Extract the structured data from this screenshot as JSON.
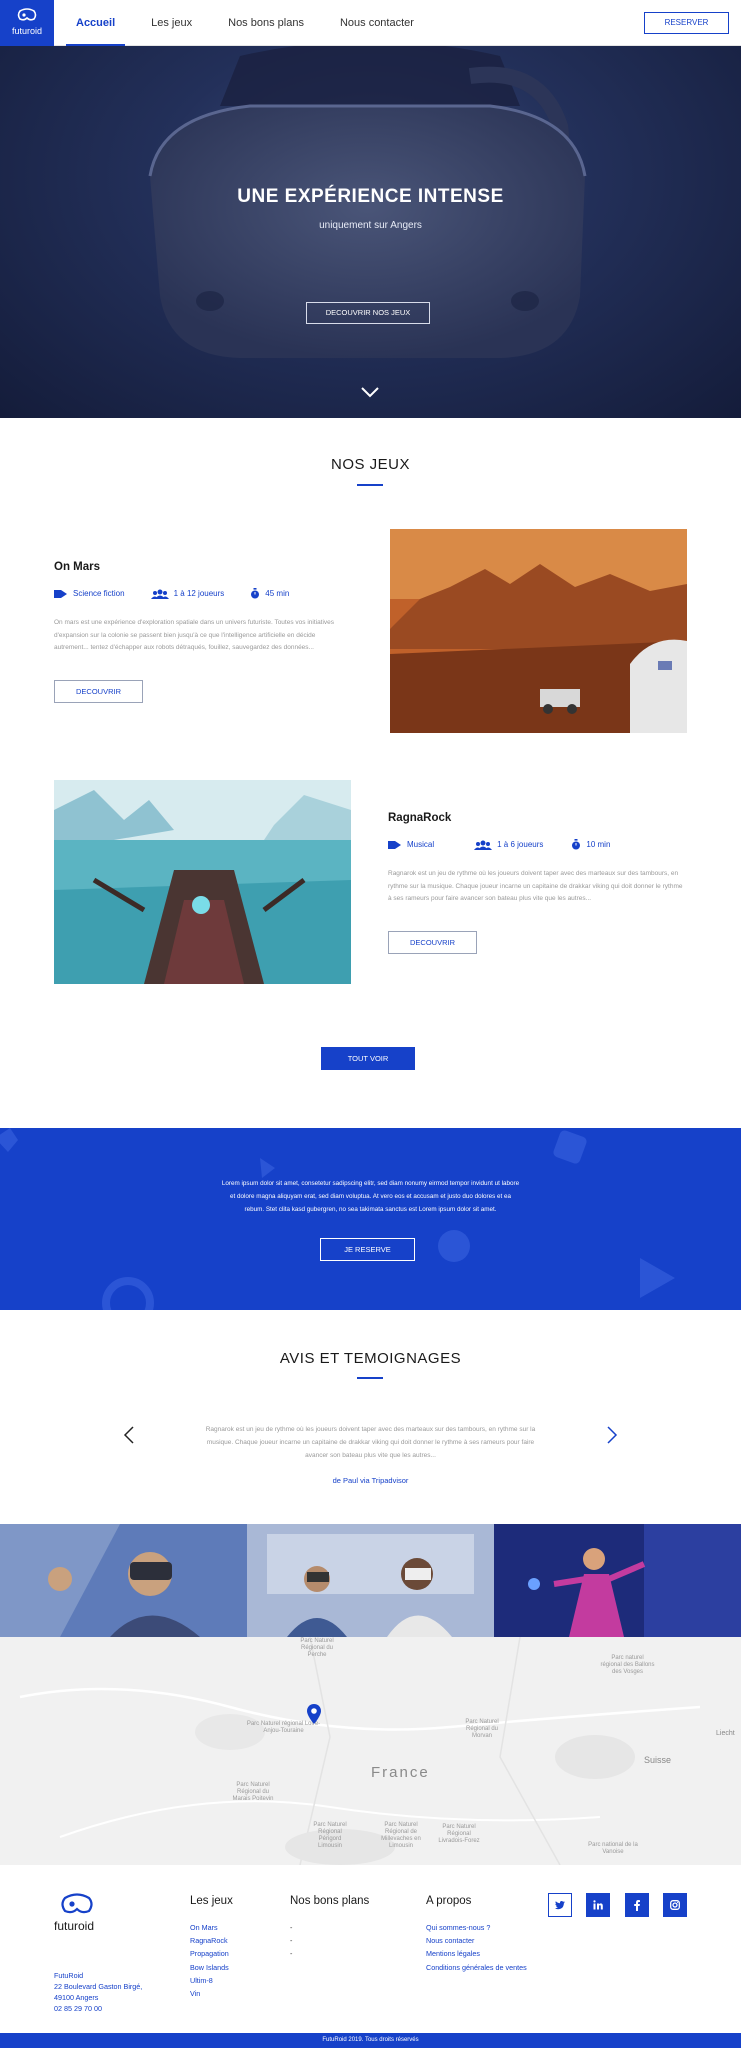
{
  "header": {
    "logo_text": "futuroid",
    "nav": [
      "Accueil",
      "Les jeux",
      "Nos bons plans",
      "Nous contacter"
    ],
    "active_nav": "Accueil",
    "reserve_label": "RESERVER"
  },
  "hero": {
    "title": "UNE EXPÉRIENCE INTENSE",
    "subtitle": "uniquement sur Angers",
    "button": "DECOUVRIR NOS JEUX"
  },
  "games_section": {
    "title": "NOS JEUX",
    "games": [
      {
        "name": "On Mars",
        "genre": "Science fiction",
        "players": "1 à 12 joueurs",
        "duration": "45 min",
        "description": "On mars est une expérience d'exploration spatiale dans un univers futuriste. Toutes vos initiatives d'expansion sur la colonie se passent bien jusqu'à ce que l'intelligence artificielle en décide autrement... tentez d'échapper aux robots détraqués, fouillez, sauvegardez des données...",
        "button": "DECOUVRIR"
      },
      {
        "name": "RagnaRock",
        "genre": "Musical",
        "players": "1 à 6 joueurs",
        "duration": "10 min",
        "description": "Ragnarok est un jeu de rythme où les joueurs doivent taper avec des marteaux sur des tambours, en rythme sur la musique. Chaque joueur incarne un capitaine de drakkar viking qui doit donner le rythme à ses rameurs pour faire avancer son bateau plus vite que les autres...",
        "button": "DECOUVRIR"
      }
    ],
    "see_all": "TOUT VOIR"
  },
  "band": {
    "text": "Lorem ipsum dolor sit amet, consetetur sadipscing elitr, sed diam nonumy eirmod tempor invidunt ut labore et dolore magna aliquyam erat, sed diam voluptua. At vero eos et accusam et justo duo dolores et ea rebum. Stet clita kasd gubergren, no sea takimata sanctus est Lorem ipsum dolor sit amet.",
    "button": "JE RESERVE"
  },
  "testimonials": {
    "title": "AVIS ET TEMOIGNAGES",
    "text": "Ragnarok est un jeu de rythme où les joueurs doivent taper avec des marteaux sur des tambours, en rythme sur la musique. Chaque joueur incarne un capitaine de drakkar viking qui doit donner le rythme à ses rameurs pour faire avancer son bateau plus vite que les autres...",
    "author": "de Paul via Tripadvisor"
  },
  "map": {
    "country": "France",
    "neighbor": "Suisse",
    "edge_label": "Liecht",
    "parks": [
      "Parc Naturel Régional du Perche",
      "Parc Naturel régional Loire-Anjou-Touraine",
      "Parc Naturel Régional du Morvan",
      "Parc naturel régional des Ballons des Vosges",
      "Parc Naturel Régional du Marais Poitevin",
      "Parc Naturel Régional Périgord Limousin",
      "Parc Naturel Régional de Millevaches en Limousin",
      "Parc Naturel Régional Livradois-Forez",
      "Parc national de la Vanoise"
    ]
  },
  "footer": {
    "logo_text": "futuroid",
    "address": [
      "FutuRoid",
      "22 Boulevard Gaston Birgé,",
      "49100 Angers",
      "02 85 29 70 00"
    ],
    "col_games_title": "Les jeux",
    "col_games": [
      "On Mars",
      "RagnaRock",
      "Propagation",
      "Bow Islands",
      "Ultim-8",
      "Vin"
    ],
    "col_deals_title": "Nos bons plans",
    "col_deals": [
      "-",
      "-",
      "-"
    ],
    "col_about_title": "A propos",
    "col_about": [
      "Qui sommes-nous ?",
      "Nous contacter",
      "Mentions légales",
      "Conditions générales de ventes"
    ],
    "social": [
      "twitter-icon",
      "linkedin-icon",
      "facebook-icon",
      "instagram-icon"
    ],
    "copyright": "FutuRoid 2019. Tous droits réservés"
  },
  "colors": {
    "brand_blue": "#1641c9",
    "hero_dark": "#1b2447",
    "map_bg": "#f1f1f1"
  }
}
